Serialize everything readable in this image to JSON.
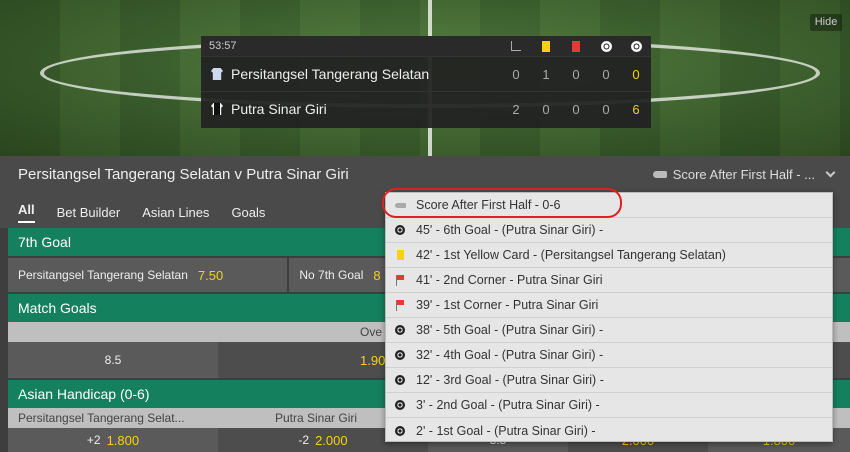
{
  "scoreboard": {
    "clock": "53:57",
    "teams": [
      {
        "name": "Persitangsel Tangerang Selatan",
        "corners": "0",
        "yellow": "1",
        "red": "0",
        "penalties": "0",
        "goals": "0"
      },
      {
        "name": "Putra Sinar Giri",
        "corners": "2",
        "yellow": "0",
        "red": "0",
        "penalties": "0",
        "goals": "6"
      }
    ]
  },
  "hide_label": "Hide",
  "event": {
    "title": "Persitangsel Tangerang Selatan v Putra Sinar Giri",
    "selector_label": "Score After First Half - ..."
  },
  "tabs": [
    "All",
    "Bet Builder",
    "Asian Lines",
    "Goals"
  ],
  "markets": {
    "seventh_goal": {
      "title": "7th Goal",
      "home_label": "Persitangsel Tangerang Selatan",
      "home_odds": "7.50",
      "none_label": "No 7th Goal",
      "none_odds": "8"
    },
    "match_goals": {
      "title": "Match Goals",
      "over_label": "Ove",
      "line": "8.5",
      "over_odds": "1.90"
    },
    "asian_handicap": {
      "title": "Asian Handicap (0-6)",
      "home_label": "Persitangsel Tangerang Selat...",
      "away_label": "Putra Sinar Giri",
      "home_line": "+2",
      "home_odds": "1.800",
      "away_line": "-2",
      "away_odds": "2.000",
      "total_line": "8.5",
      "over_odds": "2.000",
      "under_odds": "1.800"
    }
  },
  "dropdown": [
    {
      "icon": "whistle",
      "text": "Score After First Half - 0-6"
    },
    {
      "icon": "ball",
      "text": "45' - 6th Goal - (Putra Sinar Giri) -"
    },
    {
      "icon": "yellow",
      "text": "42' - 1st Yellow Card - (Persitangsel Tangerang Selatan)"
    },
    {
      "icon": "flag",
      "text": "41' - 2nd Corner - Putra Sinar Giri"
    },
    {
      "icon": "flag",
      "text": "39' - 1st Corner - Putra Sinar Giri"
    },
    {
      "icon": "ball",
      "text": "38' - 5th Goal - (Putra Sinar Giri) -"
    },
    {
      "icon": "ball",
      "text": "32' - 4th Goal - (Putra Sinar Giri) -"
    },
    {
      "icon": "ball",
      "text": "12' - 3rd Goal - (Putra Sinar Giri) -"
    },
    {
      "icon": "ball",
      "text": "3' - 2nd Goal - (Putra Sinar Giri) -"
    },
    {
      "icon": "ball",
      "text": "2' - 1st Goal - (Putra Sinar Giri) -"
    }
  ],
  "colors": {
    "accent_green": "#14805e",
    "odds_yellow": "#f7d117",
    "annotation_red": "#e02020"
  }
}
